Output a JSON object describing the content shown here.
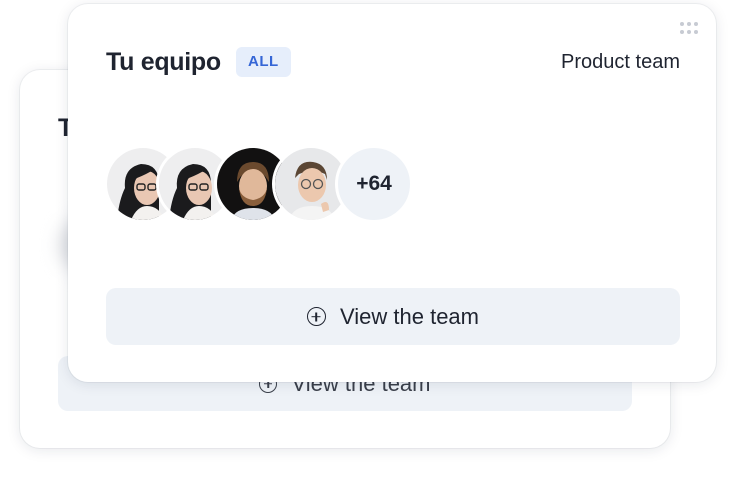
{
  "back_card": {
    "title": "T",
    "cta_label": "View the team"
  },
  "front_card": {
    "title": "Tu equipo",
    "badge": "ALL",
    "team_name": "Product team",
    "avatars": [
      "woman-with-glasses-avatar",
      "woman-with-glasses-avatar",
      "bearded-man-avatar",
      "man-with-glasses-avatar"
    ],
    "more_count": "+64",
    "cta_label": "View the team",
    "cta_icon": "plus-circle-icon"
  },
  "colors": {
    "accent": "#3566d6",
    "badge_bg": "#e6eefb",
    "button_bg": "#eef2f7",
    "text": "#1f2430"
  }
}
